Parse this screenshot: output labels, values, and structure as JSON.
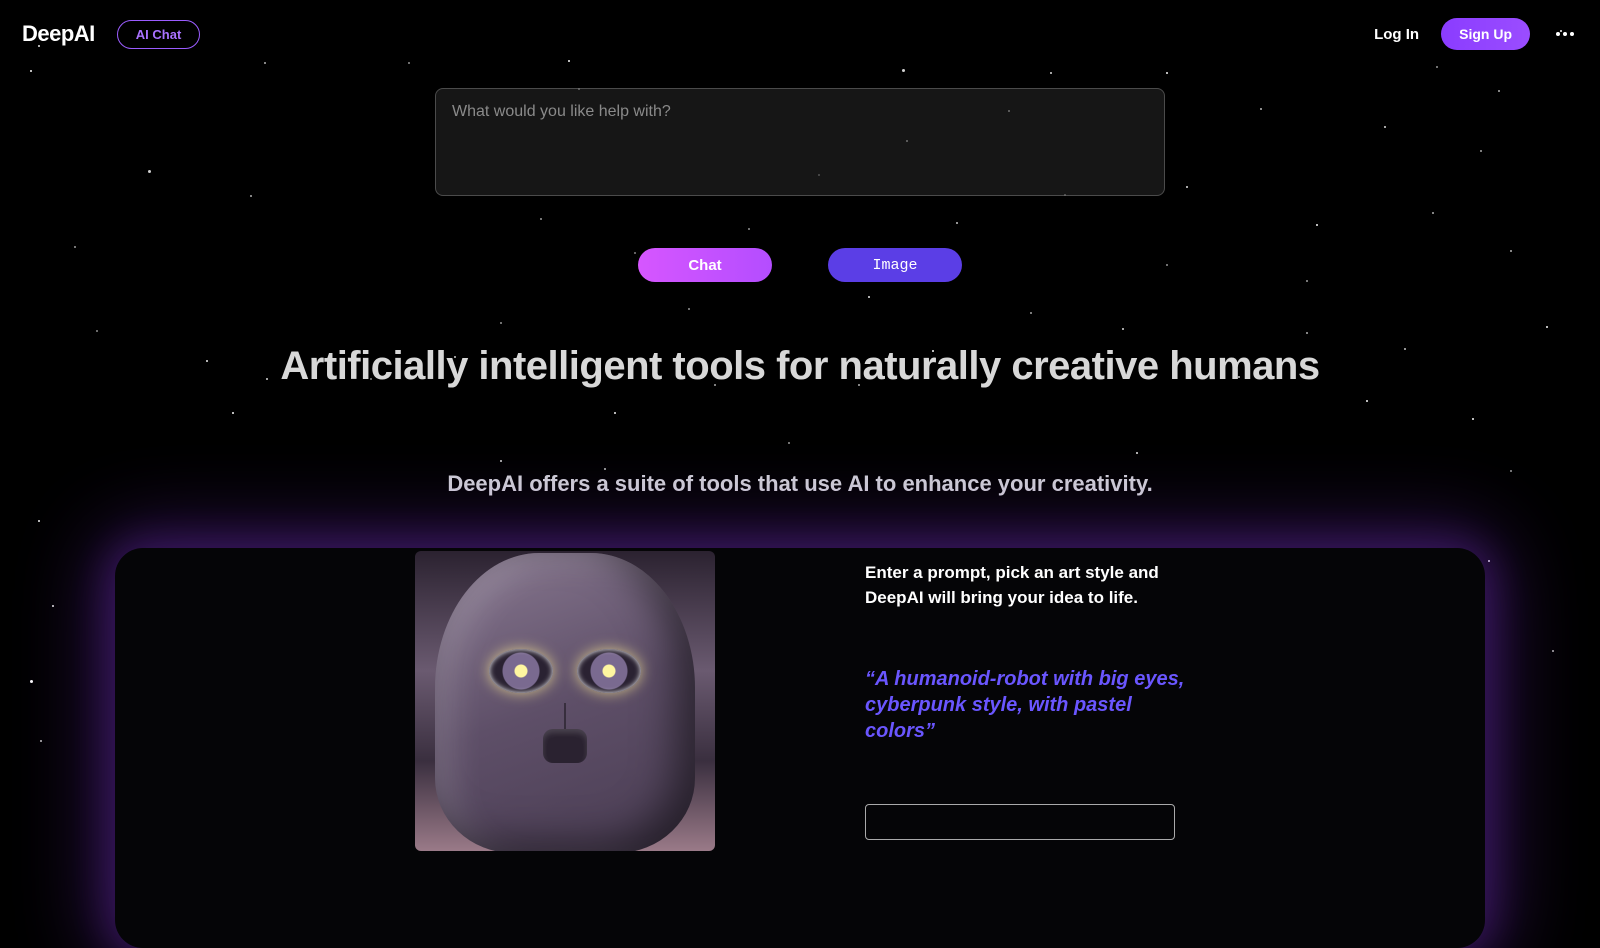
{
  "header": {
    "logo": "DeepAI",
    "ai_chat": "AI Chat",
    "login": "Log In",
    "signup": "Sign Up"
  },
  "prompt": {
    "placeholder": "What would you like help with?",
    "value": ""
  },
  "actions": {
    "chat": "Chat",
    "image": "Image"
  },
  "tagline": "Artificially intelligent tools for naturally creative humans",
  "subhead": "DeepAI offers a suite of tools that use AI to enhance your creativity.",
  "feature": {
    "desc": "Enter a prompt, pick an art style and DeepAI will bring your idea to life.",
    "quote": "“A humanoid-robot with big eyes, cyberpunk style, with pastel colors”"
  }
}
